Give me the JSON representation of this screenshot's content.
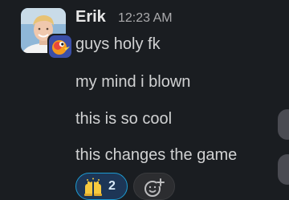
{
  "message": {
    "sender": "Erik",
    "timestamp": "12:23 AM",
    "lines": [
      "guys holy fk",
      "my mind i blown",
      "this is so cool",
      "this changes the game"
    ]
  },
  "reactions": [
    {
      "emoji": "raised-hands",
      "count": "2",
      "reacted_by_me": true
    }
  ],
  "add_reaction": {
    "icon": "add-emoji-icon"
  },
  "colors": {
    "background": "#1a1d21",
    "reaction_selected_bg": "#1d3656",
    "reaction_selected_border": "#1d9bd1",
    "timestamp": "#ababad"
  }
}
